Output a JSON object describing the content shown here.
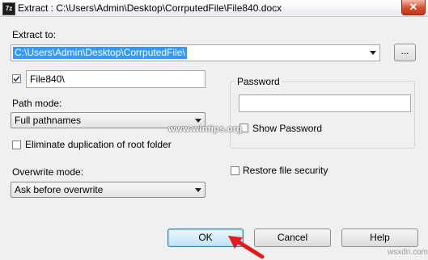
{
  "window": {
    "app_icon": "7z",
    "title": "Extract : C:\\Users\\Admin\\Desktop\\CorrputedFile\\File840.docx",
    "close_glyph": "✕"
  },
  "extract_to": {
    "label": "Extract to:",
    "path": "C:\\Users\\Admin\\Desktop\\CorrputedFile\\",
    "browse_label": "..."
  },
  "subfolder": {
    "checked": true,
    "value": "File840\\"
  },
  "path_mode": {
    "label": "Path mode:",
    "selected": "Full pathnames"
  },
  "eliminate_duplication": {
    "label": "Eliminate duplication of root folder",
    "checked": false
  },
  "overwrite_mode": {
    "label": "Overwrite mode:",
    "selected": "Ask before overwrite"
  },
  "password": {
    "label": "Password",
    "value": "",
    "show_label": "Show Password",
    "show_checked": false
  },
  "restore_security": {
    "label": "Restore file security",
    "checked": false
  },
  "buttons": {
    "ok": "OK",
    "cancel": "Cancel",
    "help": "Help"
  },
  "watermarks": {
    "site": "www.wintips.org",
    "corner": "wsxdn.com"
  },
  "annotation": {
    "arrow_color": "#e31b1b",
    "points_to": "ok-button"
  }
}
